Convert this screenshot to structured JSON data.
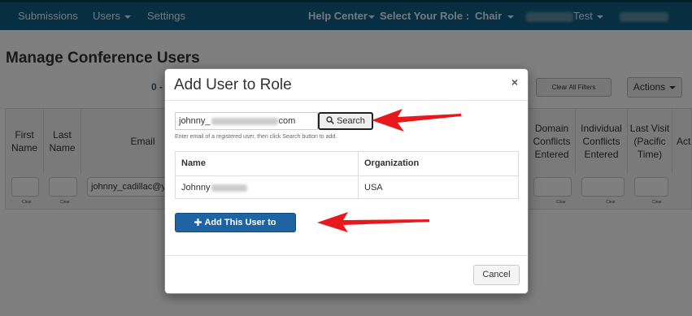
{
  "nav": {
    "left": [
      "Submissions",
      "Users",
      "Settings"
    ],
    "help_center": "Help Center",
    "role_label": "Select Your Role :",
    "role_value": "Chair",
    "user_suffix": "Test"
  },
  "page": {
    "title": "Manage Conference Users",
    "pager_prefix": "0 -",
    "clear_filters": "Clear All Filters",
    "actions": "Actions"
  },
  "grid": {
    "columns": [
      "First Name",
      "Last Name",
      "Email",
      "Domain Conflicts Entered",
      "Individual Conflicts Entered",
      "Last Visit (Pacific Time)",
      "Act"
    ],
    "email_filter": "johnny_cadillac@y",
    "clear_label": "Clear"
  },
  "modal": {
    "title": "Add User to Role",
    "close": "×",
    "email_prefix": "johnny_",
    "email_suffix": "com",
    "search_label": "Search",
    "help_text": "Enter email of a registered user, then click Search button to add.",
    "table": {
      "headers": [
        "Name",
        "Organization"
      ],
      "row": {
        "name": "Johnny",
        "organization": "USA"
      }
    },
    "add_button": "Add This User to Conference",
    "cancel": "Cancel"
  },
  "colors": {
    "topbar": "#0f5f83",
    "primary_button": "#1e64a3",
    "arrow": "#e8181d"
  },
  "icons": {
    "search": "search-icon",
    "add": "plus-icon",
    "close": "close-icon",
    "dropdown": "caret-down-icon"
  }
}
